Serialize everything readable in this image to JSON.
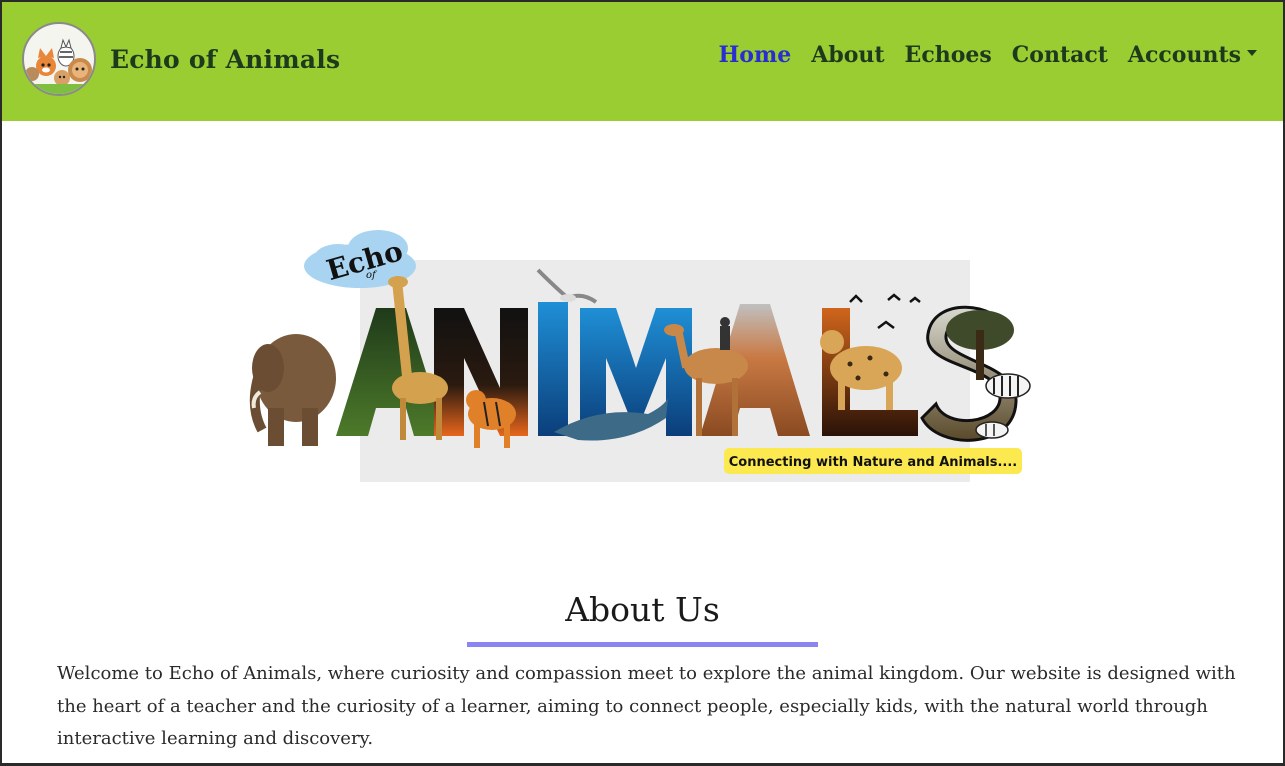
{
  "site": {
    "brand_name": "Echo of Animals",
    "logo_icon": "cartoon-animals-logo-icon"
  },
  "nav": {
    "items": [
      {
        "label": "Home",
        "active": true
      },
      {
        "label": "About",
        "active": false
      },
      {
        "label": "Echoes",
        "active": false
      },
      {
        "label": "Contact",
        "active": false
      },
      {
        "label": "Accounts",
        "active": false,
        "dropdown": true
      }
    ]
  },
  "hero": {
    "echo_text": "Echo",
    "of_text": "of",
    "animals_text": "ANIMALS",
    "tagline": "Connecting with Nature and Animals...."
  },
  "about": {
    "title": "About Us",
    "body": "Welcome to Echo of Animals, where curiosity and compassion meet to explore the animal kingdom. Our website is designed with the heart of a teacher and the curiosity of a learner, aiming to connect people, especially kids, with the natural world through interactive learning and discovery."
  },
  "colors": {
    "navbar_bg": "#9acd32",
    "nav_text": "#1d3a1d",
    "nav_active": "#2a2ed0",
    "underline": "#8b85f2",
    "tagline_bg": "#fce94f"
  }
}
